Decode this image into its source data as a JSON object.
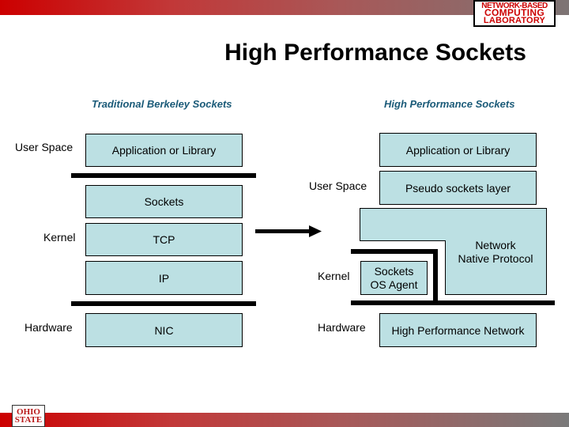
{
  "slide": {
    "title": "High Performance Sockets",
    "colors": {
      "header_gradient_start": "#cc0000",
      "header_gradient_end": "#7a7a7a",
      "box_fill": "#bce0e3",
      "subheading": "#1a5a78"
    }
  },
  "logos": {
    "lab": [
      "NETWORK-BASED",
      "COMPUTING",
      "LABORATORY"
    ],
    "university": [
      "OHIO",
      "STATE"
    ]
  },
  "traditional": {
    "heading": "Traditional Berkeley Sockets",
    "layer_labels": {
      "user_space": "User Space",
      "kernel": "Kernel",
      "hardware": "Hardware"
    },
    "boxes": {
      "application": "Application or Library",
      "sockets": "Sockets",
      "tcp": "TCP",
      "ip": "IP",
      "nic": "NIC"
    }
  },
  "high_performance": {
    "heading": "High Performance Sockets",
    "layer_labels": {
      "user_space": "User Space",
      "kernel": "Kernel",
      "hardware": "Hardware"
    },
    "boxes": {
      "application": "Application or Library",
      "pseudo_sockets": "Pseudo sockets layer",
      "native_protocol": [
        "Network",
        "Native Protocol"
      ],
      "os_agent": [
        "Sockets",
        "OS Agent"
      ],
      "network": "High Performance Network"
    }
  },
  "arrow": {
    "icon": "right-arrow-icon"
  }
}
